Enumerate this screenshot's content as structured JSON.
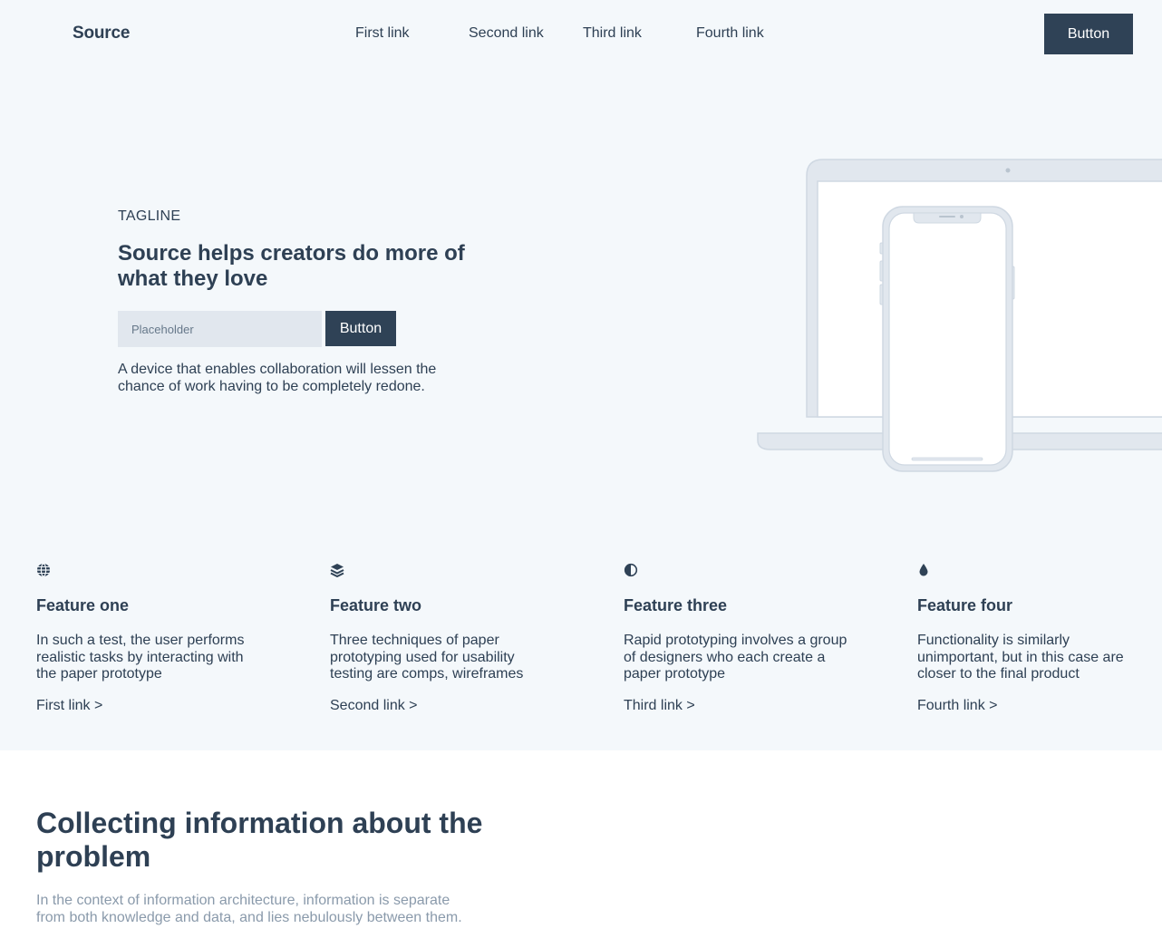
{
  "nav": {
    "brand": "Source",
    "links": [
      "First link",
      "Second link",
      "Third link",
      "Fourth link"
    ],
    "button_label": "Button"
  },
  "hero": {
    "tagline": "TAGLINE",
    "title": "Source helps creators do more of what they love",
    "input_placeholder": "Placeholder",
    "button_label": "Button",
    "description": "A device that enables collaboration will lessen the chance of work having to be completely redone."
  },
  "features": [
    {
      "icon": "globe-icon",
      "title": "Feature one",
      "description": "In such a test, the user performs realistic tasks by interacting with the paper prototype",
      "link": "First link >"
    },
    {
      "icon": "layers-icon",
      "title": "Feature two",
      "description": "Three techniques of paper prototyping used for usability testing are comps, wireframes",
      "link": "Second link >"
    },
    {
      "icon": "contrast-icon",
      "title": "Feature three",
      "description": "Rapid prototyping involves a group of designers who each create a paper prototype",
      "link": "Third link >"
    },
    {
      "icon": "droplet-icon",
      "title": "Feature four",
      "description": "Functionality is similarly unimportant, but in this case are closer to the final product",
      "link": "Fourth link >"
    }
  ],
  "section": {
    "title": "Collecting information about the problem",
    "description": "In the context of information architecture, information is separate from both knowledge and data, and lies nebulously between them."
  },
  "colors": {
    "background": "#f4f8fb",
    "text": "#2e4054",
    "button": "#2f4256",
    "muted": "#8a9aab"
  }
}
